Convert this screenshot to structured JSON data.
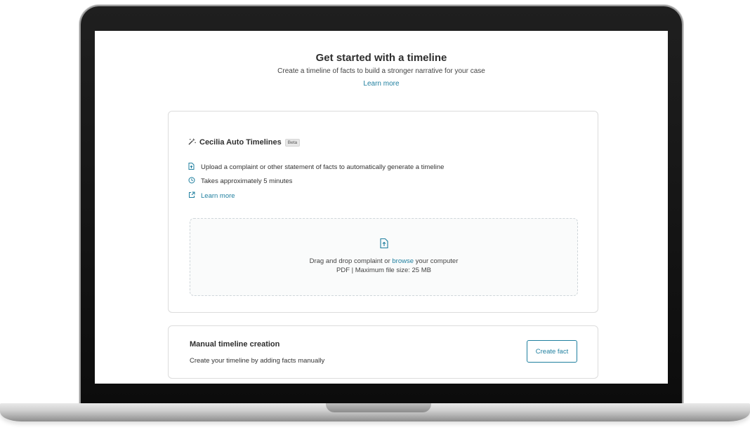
{
  "hero": {
    "title": "Get started with a timeline",
    "subtitle": "Create a timeline of facts to build a stronger narrative for your case",
    "learn_more": "Learn more"
  },
  "auto": {
    "icon": "magic-wand-icon",
    "title": "Cecilia Auto Timelines",
    "badge": "Beta",
    "features": [
      {
        "icon": "document-upload-icon",
        "text": "Upload a complaint or other statement of facts to automatically generate a timeline"
      },
      {
        "icon": "clock-icon",
        "text": "Takes approximately 5 minutes"
      },
      {
        "icon": "external-link-icon",
        "text": "Learn more"
      }
    ],
    "dropzone": {
      "icon": "file-upload-icon",
      "prefix": "Drag and drop complaint or ",
      "browse": "browse",
      "suffix": " your computer",
      "hint": "PDF | Maximum file size: 25 MB"
    }
  },
  "manual": {
    "title": "Manual timeline creation",
    "subtitle": "Create your timeline by adding facts manually",
    "button": "Create fact"
  },
  "colors": {
    "accent": "#1f7f9f",
    "border": "#dcdcdc"
  }
}
